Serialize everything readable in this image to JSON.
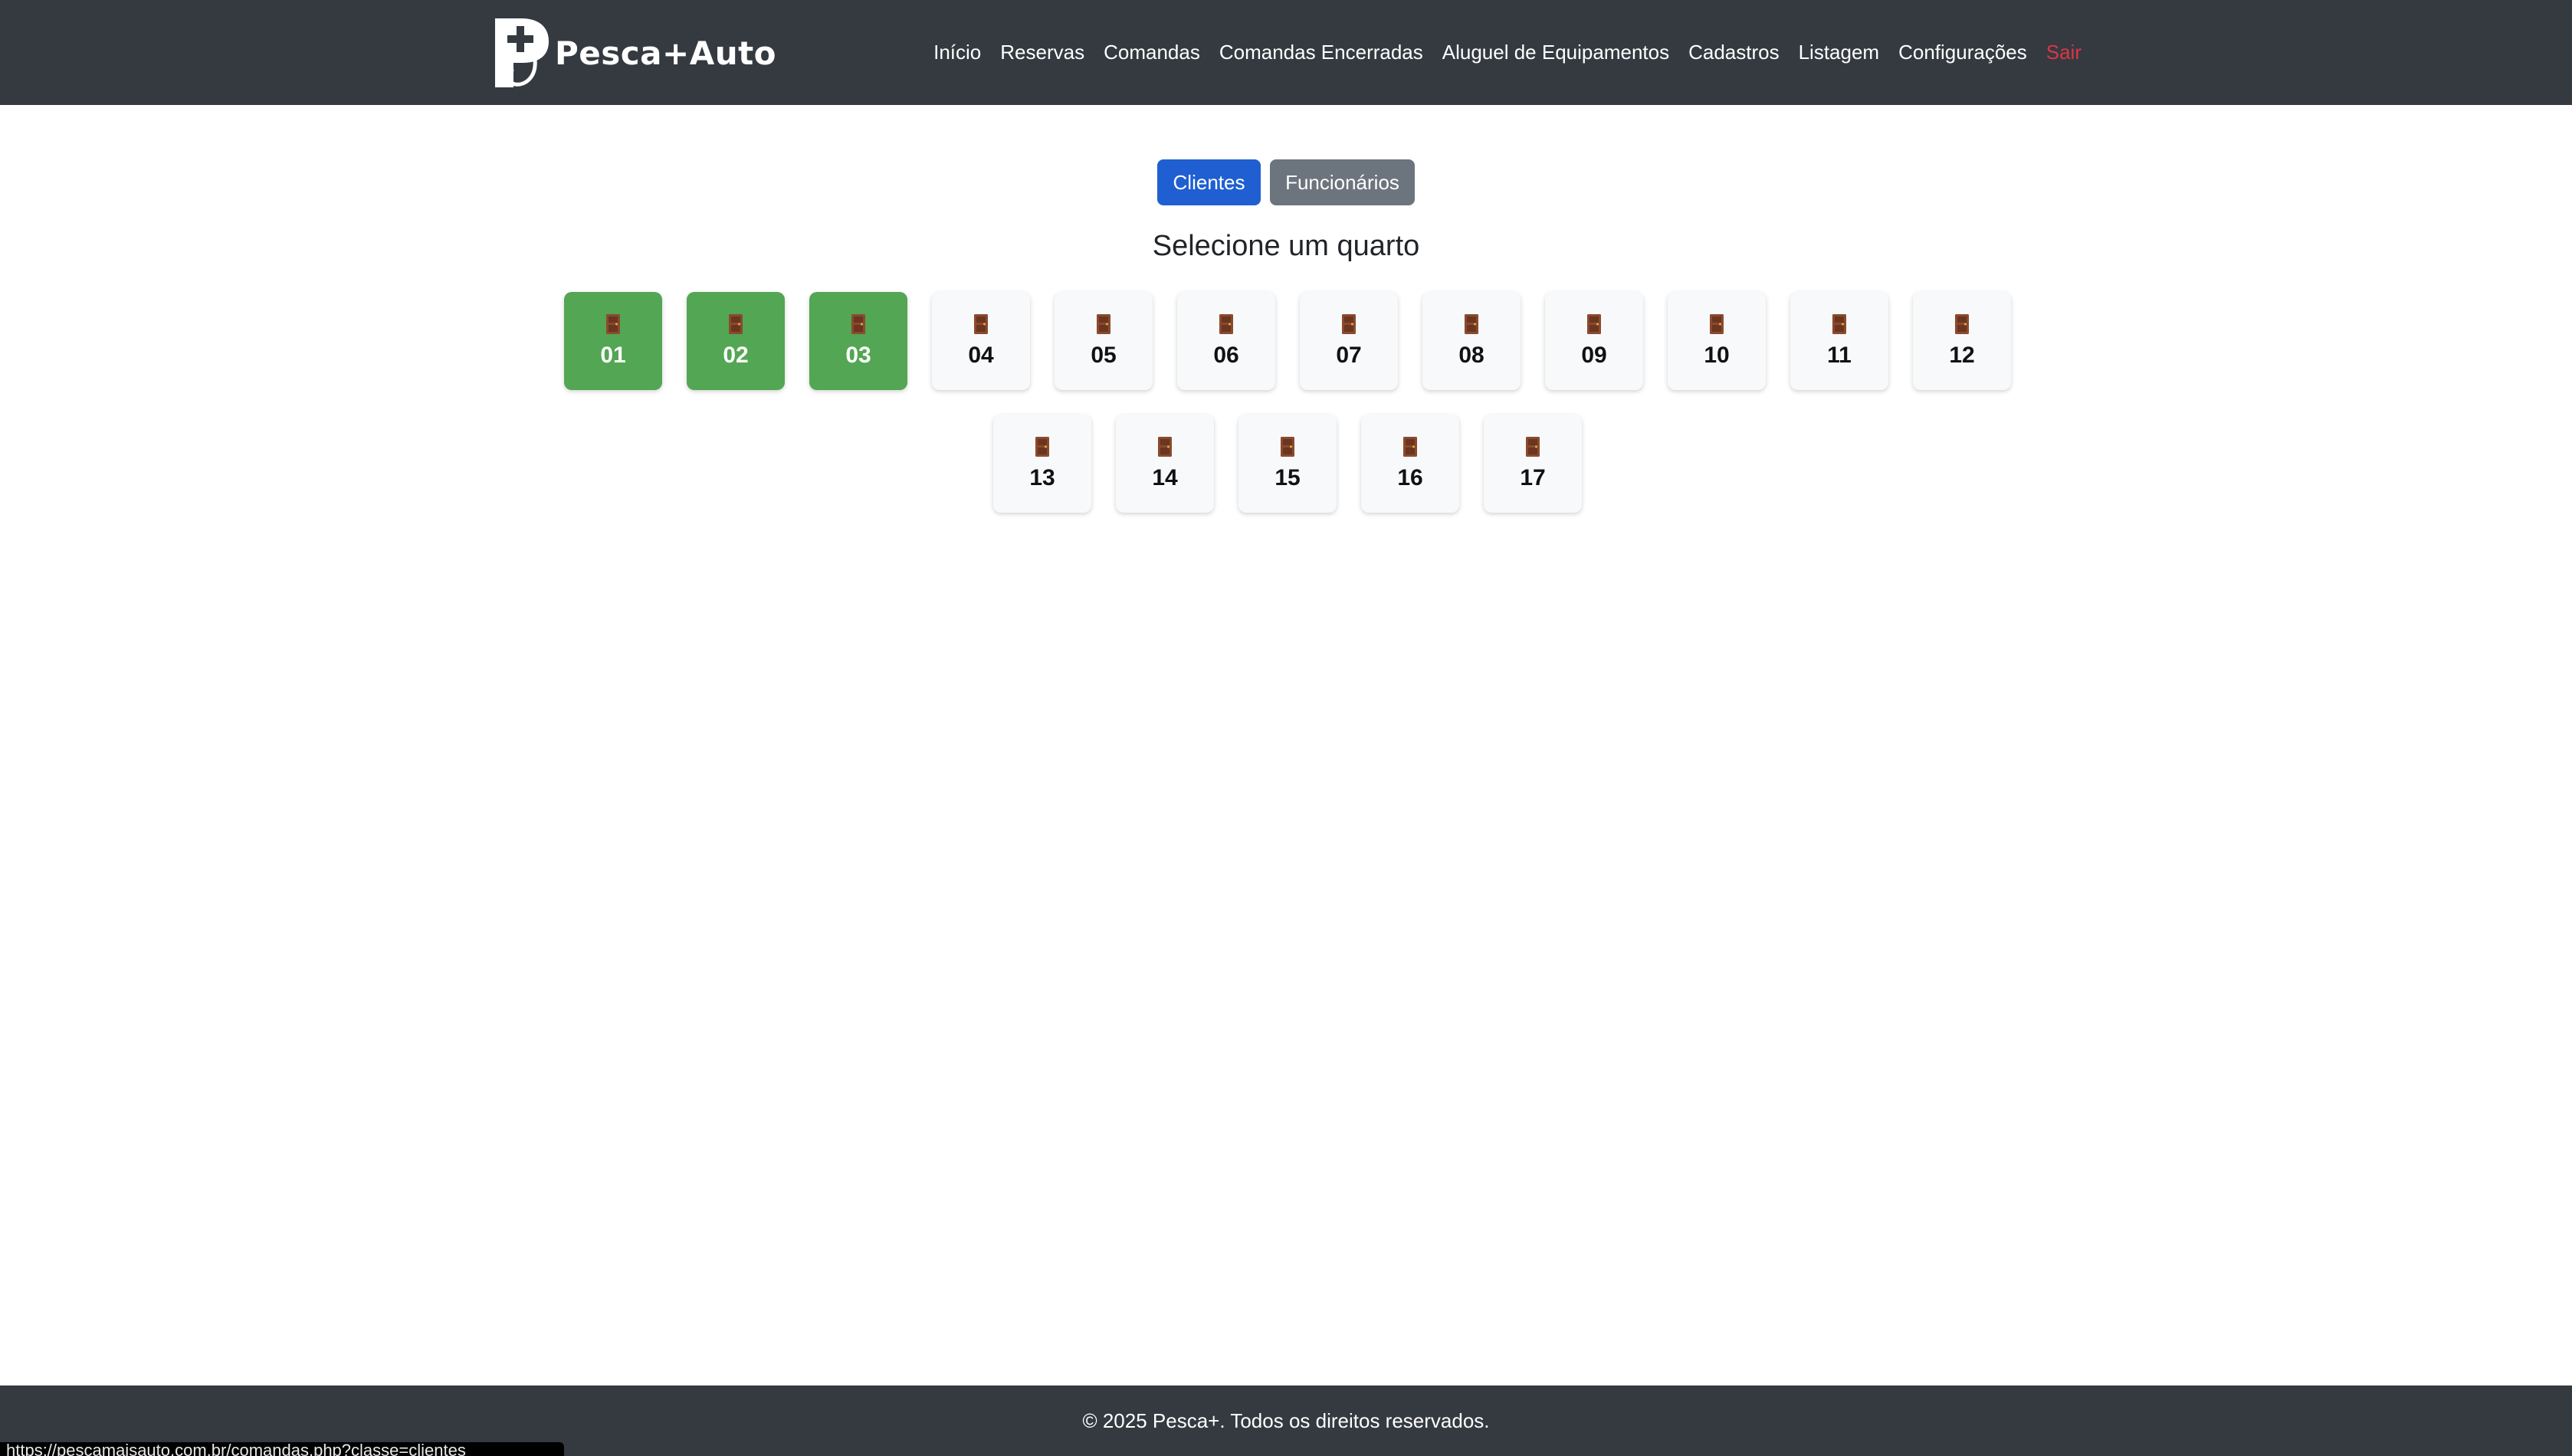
{
  "brand": {
    "name": "Pesca+Auto"
  },
  "nav": {
    "items": [
      {
        "label": "Início"
      },
      {
        "label": "Reservas"
      },
      {
        "label": "Comandas"
      },
      {
        "label": "Comandas Encerradas"
      },
      {
        "label": "Aluguel de Equipamentos"
      },
      {
        "label": "Cadastros"
      },
      {
        "label": "Listagem"
      },
      {
        "label": "Configurações"
      },
      {
        "label": "Sair"
      }
    ]
  },
  "toggle": {
    "clientes_label": "Clientes",
    "funcionarios_label": "Funcionários",
    "selected": "Clientes"
  },
  "page": {
    "heading": "Selecione um quarto"
  },
  "rooms": [
    {
      "number": "01",
      "occupied": true
    },
    {
      "number": "02",
      "occupied": true
    },
    {
      "number": "03",
      "occupied": true
    },
    {
      "number": "04",
      "occupied": false
    },
    {
      "number": "05",
      "occupied": false
    },
    {
      "number": "06",
      "occupied": false
    },
    {
      "number": "07",
      "occupied": false
    },
    {
      "number": "08",
      "occupied": false
    },
    {
      "number": "09",
      "occupied": false
    },
    {
      "number": "10",
      "occupied": false
    },
    {
      "number": "11",
      "occupied": false
    },
    {
      "number": "12",
      "occupied": false
    },
    {
      "number": "13",
      "occupied": false
    },
    {
      "number": "14",
      "occupied": false
    },
    {
      "number": "15",
      "occupied": false
    },
    {
      "number": "16",
      "occupied": false
    },
    {
      "number": "17",
      "occupied": false
    }
  ],
  "room_icon": "door-icon",
  "colors": {
    "navbar": "#343a40",
    "primary": "#1f5fd1",
    "secondary": "#6c757d",
    "occupied": "#53a653",
    "free": "#f8f9fa",
    "danger": "#dc3545"
  },
  "footer": {
    "text": "© 2025 Pesca+. Todos os direitos reservados."
  },
  "status_bar": {
    "url": "https://pescamaisauto.com.br/comandas.php?classe=clientes"
  }
}
